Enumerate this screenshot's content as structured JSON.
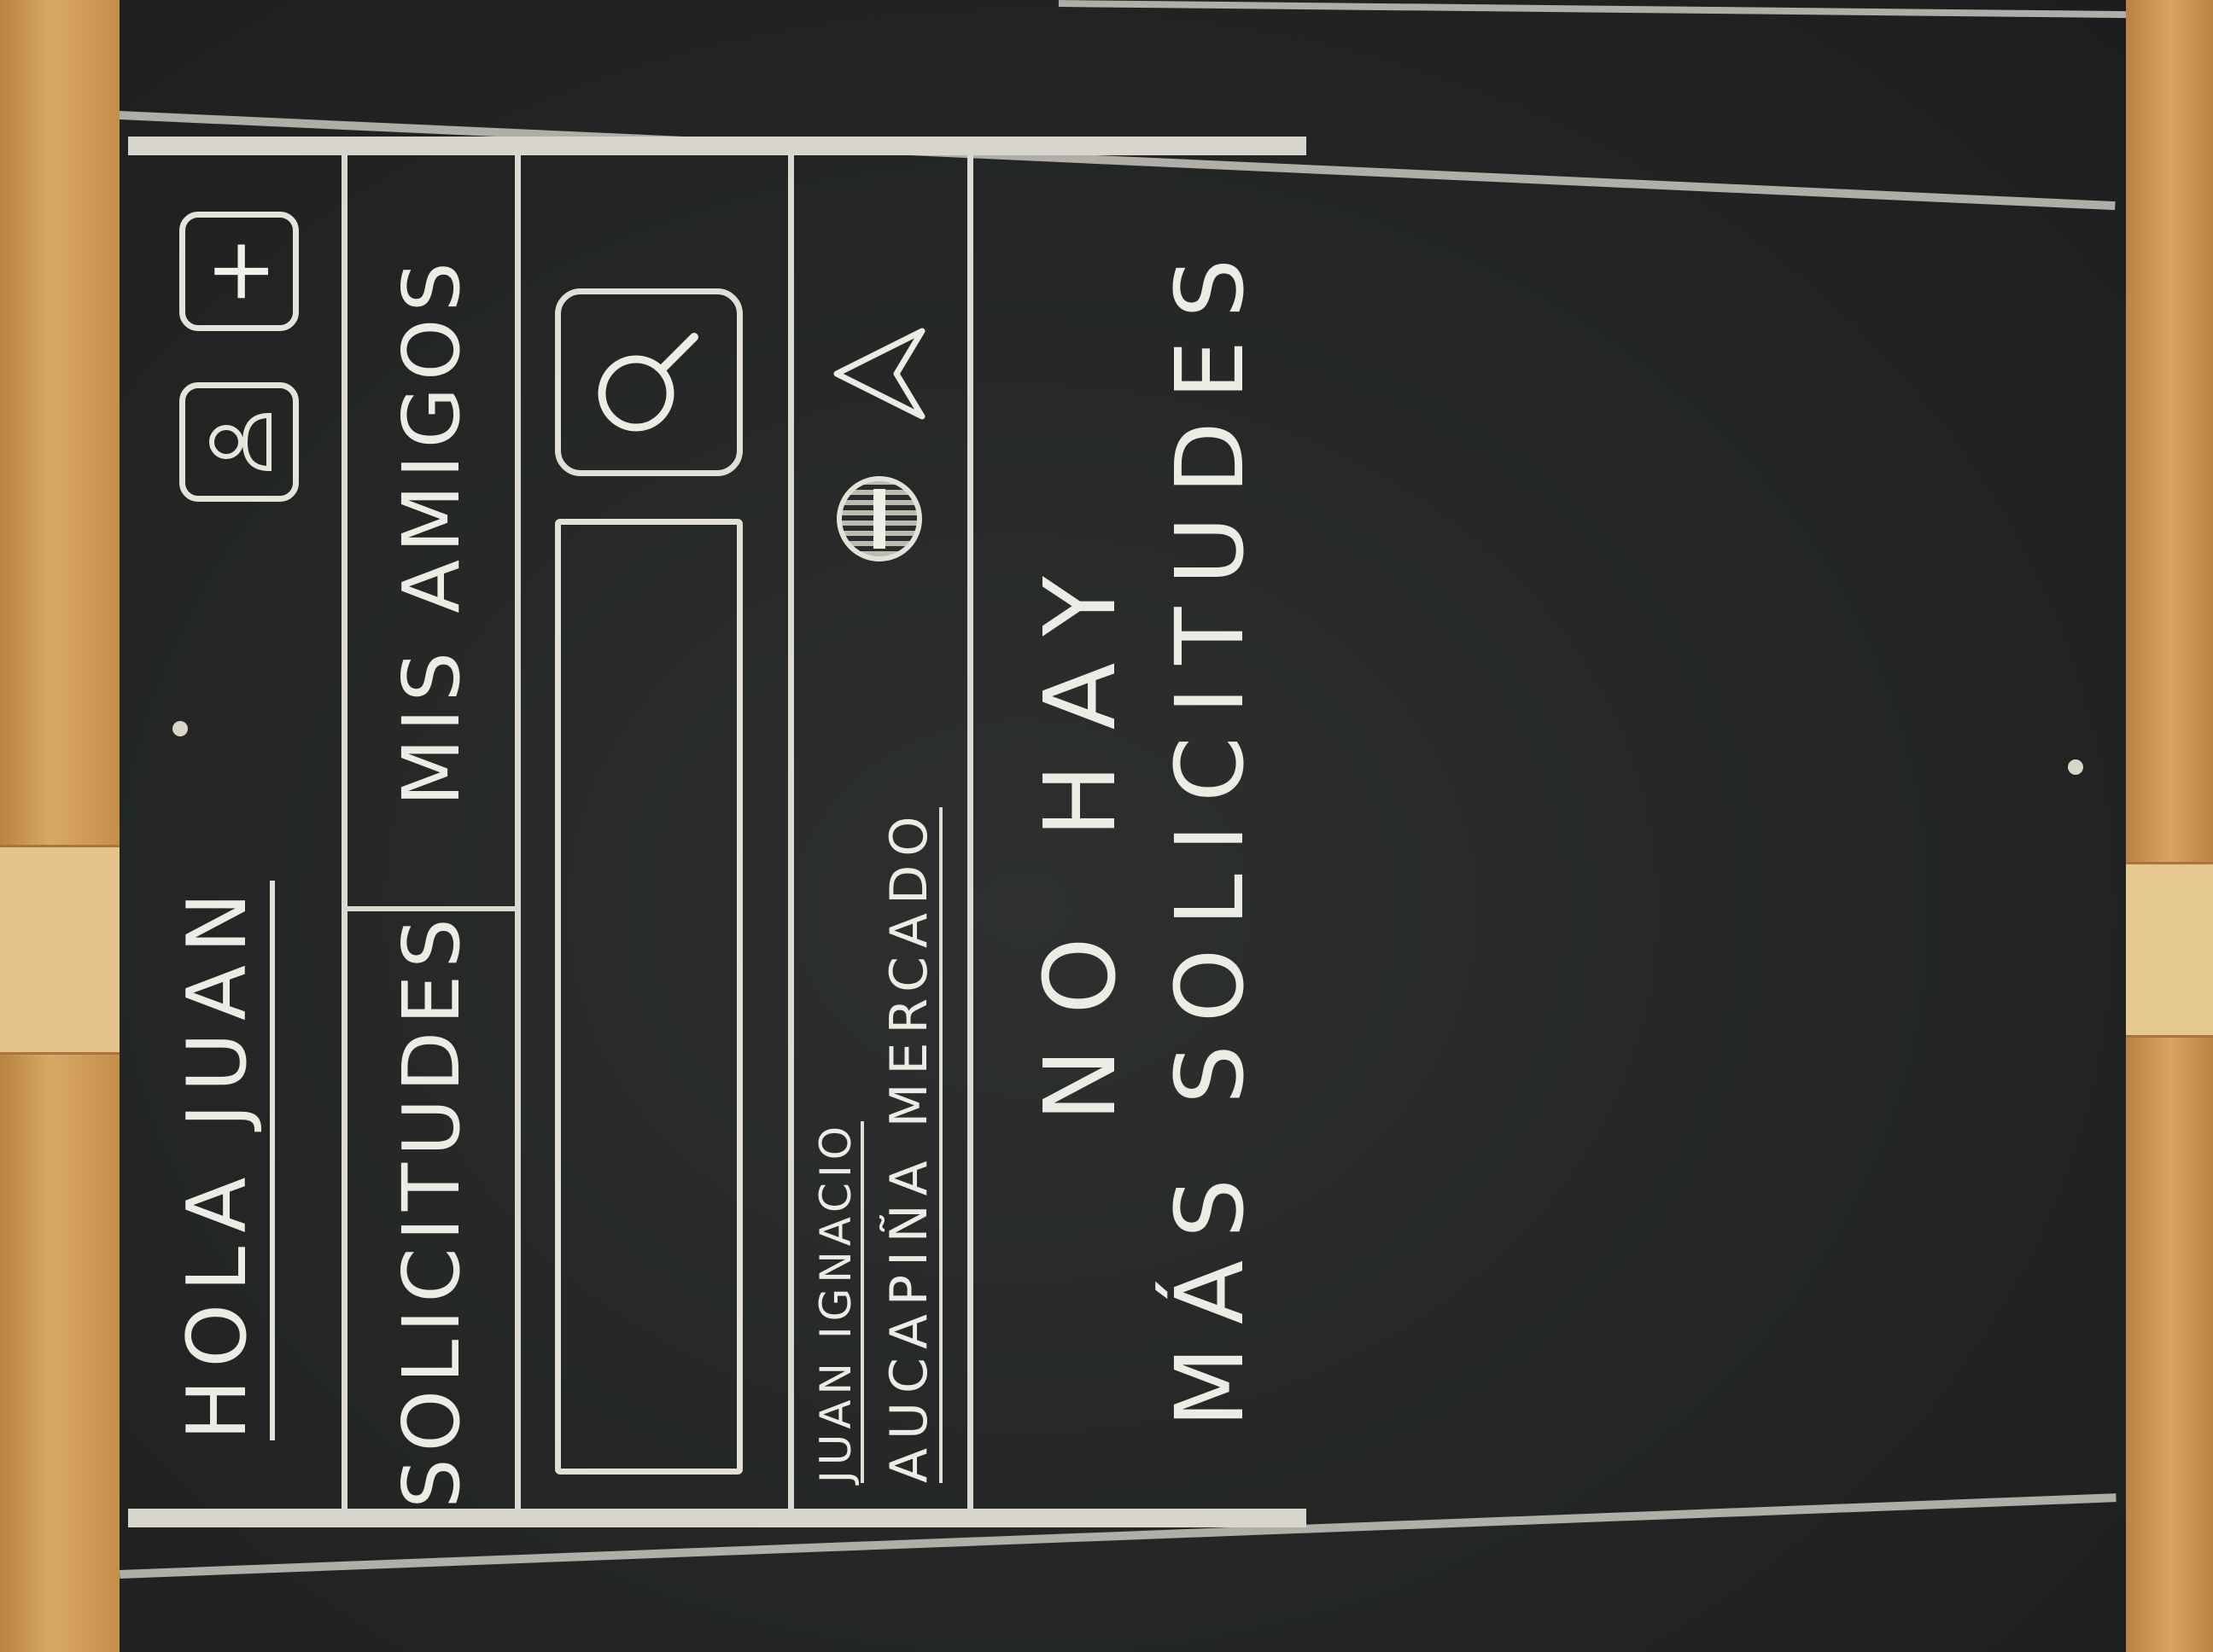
{
  "header": {
    "greeting": "HOLA JUAN",
    "profile_icon": "person-icon",
    "add_icon": "plus-icon",
    "add_glyph": "+"
  },
  "tabs": [
    {
      "label": "SOLICITUDES"
    },
    {
      "label": "MIS AMIGOS"
    }
  ],
  "search": {
    "icon": "search-icon"
  },
  "request": {
    "name": "JUAN IGNACIO",
    "surname": "AUCAPIÑA MERCADO",
    "reject_icon": "reject-icon",
    "accept_icon": "accept-icon"
  },
  "empty_state": {
    "line1": "NO HAY",
    "line2": "MÁS SOLICITUDES"
  }
}
